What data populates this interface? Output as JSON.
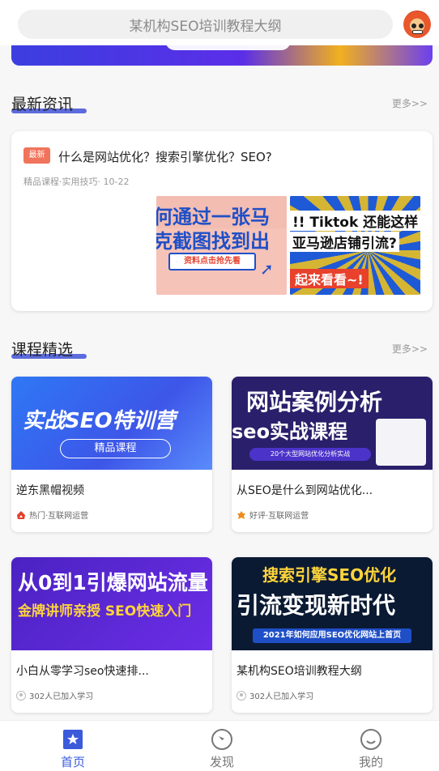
{
  "header": {
    "search_placeholder": "某机构SEO培训教程大纲"
  },
  "news_section": {
    "title": "最新资讯",
    "more": "更多>>",
    "item": {
      "tag": "最新",
      "title": "什么是网站优化？搜索引擎优化？SEO?",
      "meta": "精品课程·实用技巧· 10-22",
      "image2_text": [
        "何通过一张马",
        "克截图找到出",
        "资料点击抢先看"
      ],
      "image3_text": [
        "!! Tiktok 还能这样",
        "亚马逊店铺引流?",
        "起来看看~!"
      ]
    }
  },
  "course_section": {
    "title": "课程精选",
    "more": "更多>>",
    "courses": [
      {
        "name": "逆东黑帽视频",
        "meta": "热门·互联网运营",
        "icon": "fire-icon",
        "cover_lines": [
          "实战SEO特训营",
          "精品课程"
        ]
      },
      {
        "name": "从SEO是什么到网站优化...",
        "meta": "好评·互联网运营",
        "icon": "thumb-icon",
        "cover_lines": [
          "网站案例分析",
          "seo实战课程",
          "20个大型网站优化分析实战"
        ]
      },
      {
        "name": "小白从零学习seo快速排...",
        "meta": "302人已加入学习",
        "icon": "user-icon",
        "cover_lines": [
          "从0到1引爆网站流量",
          "金牌讲师亲授 SEO快速入门"
        ]
      },
      {
        "name": "某机构SEO培训教程大纲",
        "meta": "302人已加入学习",
        "icon": "user-icon",
        "cover_lines": [
          "搜索引擎SEO优化",
          "引流变现新时代",
          "2021年如何应用SEO优化网站上首页"
        ]
      }
    ]
  },
  "tabbar": {
    "tabs": [
      {
        "label": "首页",
        "icon": "home-bookmark-icon",
        "active": true
      },
      {
        "label": "发现",
        "icon": "compass-icon",
        "active": false
      },
      {
        "label": "我的",
        "icon": "smile-icon",
        "active": false
      }
    ]
  },
  "colors": {
    "accent": "#3b5bdb",
    "tag": "#f0745c",
    "underline": "#4a5bd9"
  }
}
